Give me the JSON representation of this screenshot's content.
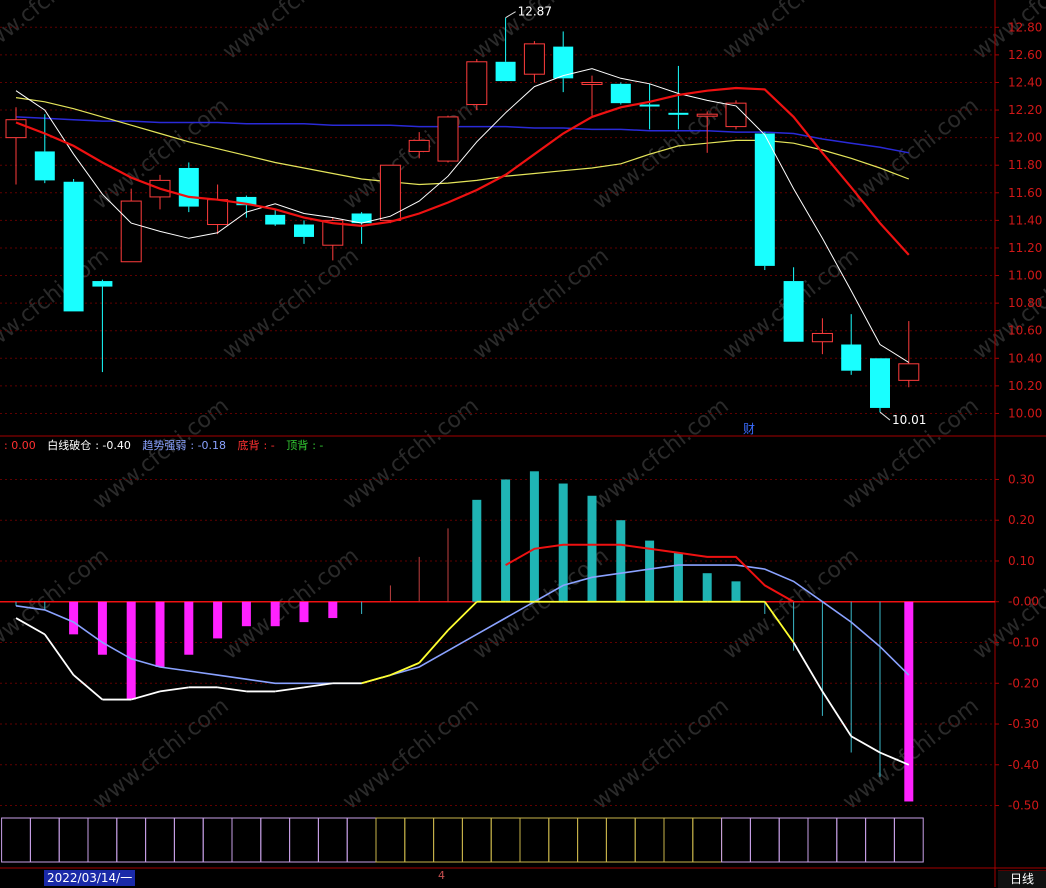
{
  "chart_data": [
    {
      "type": "candlestick",
      "panel": "price",
      "y_ticks": [
        "12.80",
        "12.60",
        "12.40",
        "12.20",
        "12.00",
        "11.80",
        "11.60",
        "11.40",
        "11.20",
        "11.00",
        "10.80",
        "10.60",
        "10.40",
        "10.20",
        "10.00"
      ],
      "ylim": [
        9.88,
        12.94
      ],
      "grid": true,
      "candles": [
        {
          "o": 12.0,
          "c": 12.13,
          "h": 12.22,
          "l": 11.66
        },
        {
          "o": 11.9,
          "c": 11.69,
          "h": 12.17,
          "l": 11.67
        },
        {
          "o": 11.68,
          "c": 10.74,
          "h": 11.7,
          "l": 10.74
        },
        {
          "o": 10.96,
          "c": 10.92,
          "h": 10.97,
          "l": 10.3
        },
        {
          "o": 11.1,
          "c": 11.54,
          "h": 11.63,
          "l": 11.1
        },
        {
          "o": 11.57,
          "c": 11.69,
          "h": 11.73,
          "l": 11.48
        },
        {
          "o": 11.78,
          "c": 11.5,
          "h": 11.82,
          "l": 11.46
        },
        {
          "o": 11.37,
          "c": 11.55,
          "h": 11.66,
          "l": 11.3
        },
        {
          "o": 11.57,
          "c": 11.51,
          "h": 11.58,
          "l": 11.42
        },
        {
          "o": 11.44,
          "c": 11.37,
          "h": 11.48,
          "l": 11.36
        },
        {
          "o": 11.37,
          "c": 11.28,
          "h": 11.4,
          "l": 11.23
        },
        {
          "o": 11.22,
          "c": 11.4,
          "h": 11.42,
          "l": 11.11
        },
        {
          "o": 11.45,
          "c": 11.38,
          "h": 11.46,
          "l": 11.23
        },
        {
          "o": 11.4,
          "c": 11.8,
          "h": 11.8,
          "l": 11.38
        },
        {
          "o": 11.9,
          "c": 11.98,
          "h": 12.04,
          "l": 11.85
        },
        {
          "o": 11.83,
          "c": 12.15,
          "h": 12.16,
          "l": 11.82
        },
        {
          "o": 12.24,
          "c": 12.55,
          "h": 12.57,
          "l": 12.2
        },
        {
          "o": 12.55,
          "c": 12.41,
          "h": 12.87,
          "l": 12.41
        },
        {
          "o": 12.46,
          "c": 12.68,
          "h": 12.7,
          "l": 12.4
        },
        {
          "o": 12.66,
          "c": 12.43,
          "h": 12.77,
          "l": 12.33
        },
        {
          "o": 12.4,
          "c": 12.4,
          "h": 12.45,
          "l": 12.16
        },
        {
          "o": 12.39,
          "c": 12.25,
          "h": 12.4,
          "l": 12.24
        },
        {
          "o": 12.24,
          "c": 12.23,
          "h": 12.39,
          "l": 12.06
        },
        {
          "o": 12.18,
          "c": 12.17,
          "h": 12.52,
          "l": 12.06
        },
        {
          "o": 12.16,
          "c": 12.17,
          "h": 12.19,
          "l": 11.89
        },
        {
          "o": 12.08,
          "c": 12.25,
          "h": 12.27,
          "l": 12.06
        },
        {
          "o": 12.03,
          "c": 11.07,
          "h": 12.04,
          "l": 11.04
        },
        {
          "o": 10.96,
          "c": 10.52,
          "h": 11.06,
          "l": 10.52
        },
        {
          "o": 10.52,
          "c": 10.58,
          "h": 10.69,
          "l": 10.43
        },
        {
          "o": 10.5,
          "c": 10.31,
          "h": 10.72,
          "l": 10.28
        },
        {
          "o": 10.4,
          "c": 10.04,
          "h": 10.4,
          "l": 10.01
        },
        {
          "o": 10.24,
          "c": 10.36,
          "h": 10.67,
          "l": 10.19
        }
      ],
      "ma_white": [
        12.34,
        12.2,
        11.88,
        11.59,
        11.38,
        11.32,
        11.27,
        11.31,
        11.46,
        11.52,
        11.45,
        11.42,
        11.38,
        11.43,
        11.54,
        11.72,
        11.97,
        12.18,
        12.37,
        12.45,
        12.5,
        12.43,
        12.39,
        12.32,
        12.27,
        12.23,
        12.02,
        11.63,
        11.27,
        10.89,
        10.5,
        10.37
      ],
      "ma_yellow": [
        12.29,
        12.26,
        12.21,
        12.15,
        12.09,
        12.03,
        11.97,
        11.92,
        11.87,
        11.82,
        11.78,
        11.74,
        11.7,
        11.68,
        11.66,
        11.67,
        11.69,
        11.72,
        11.74,
        11.76,
        11.78,
        11.81,
        11.88,
        11.94,
        11.96,
        11.98,
        11.98,
        11.96,
        11.91,
        11.85,
        11.78,
        11.7
      ],
      "ma_red": [
        12.11,
        12.03,
        11.94,
        11.82,
        11.71,
        11.63,
        11.57,
        11.55,
        11.52,
        11.48,
        11.42,
        11.38,
        11.36,
        11.39,
        11.45,
        11.53,
        11.62,
        11.73,
        11.88,
        12.03,
        12.15,
        12.22,
        12.26,
        12.31,
        12.34,
        12.36,
        12.35,
        12.15,
        11.89,
        11.64,
        11.38,
        11.15
      ],
      "ma_blue": [
        12.15,
        12.14,
        12.13,
        12.12,
        12.12,
        12.11,
        12.11,
        12.11,
        12.1,
        12.1,
        12.1,
        12.09,
        12.09,
        12.09,
        12.08,
        12.08,
        12.08,
        12.08,
        12.07,
        12.07,
        12.06,
        12.06,
        12.05,
        12.05,
        12.05,
        12.04,
        12.04,
        12.03,
        11.99,
        11.96,
        11.93,
        11.89
      ],
      "annotations": [
        {
          "index": 17,
          "value": 12.87,
          "label": "12.87"
        },
        {
          "index": 30,
          "value": 10.01,
          "label": "10.01"
        }
      ],
      "marker_label": "财"
    },
    {
      "type": "bar",
      "panel": "indicator",
      "y_ticks": [
        "0.30",
        "0.20",
        "0.10",
        "-0.00",
        "-0.10",
        "-0.20",
        "-0.30",
        "-0.40",
        "-0.50"
      ],
      "ylim": [
        -0.56,
        0.36
      ],
      "series": [
        {
          "values": [
            -0.01,
            -0.02,
            -0.08,
            -0.13,
            -0.24,
            -0.16,
            -0.13,
            -0.09,
            -0.06,
            -0.06,
            -0.05,
            -0.04,
            -0.03,
            0.04,
            0.11,
            0.18,
            0.25,
            0.3,
            0.32,
            0.29,
            0.26,
            0.2,
            0.15,
            0.12,
            0.07,
            0.05,
            -0.03,
            -0.12,
            -0.28,
            -0.37,
            -0.43,
            -0.49
          ]
        },
        {
          "values": [
            -0.04,
            -0.08,
            -0.18,
            -0.24,
            -0.24,
            -0.22,
            -0.21,
            -0.21,
            -0.22,
            -0.22,
            -0.21,
            -0.2,
            -0.2,
            -0.18,
            -0.15,
            -0.07,
            0.0,
            0.0,
            0.0,
            0.0,
            0.0,
            0.0,
            0.0,
            0.0,
            0.0,
            0.0,
            0.0,
            -0.1,
            -0.22,
            -0.33,
            -0.37,
            -0.4
          ]
        },
        {
          "values": [
            -0.01,
            -0.02,
            -0.05,
            -0.1,
            -0.14,
            -0.16,
            -0.17,
            -0.18,
            -0.19,
            -0.2,
            -0.2,
            -0.2,
            -0.2,
            -0.18,
            -0.16,
            -0.12,
            -0.08,
            -0.04,
            0.0,
            0.04,
            0.06,
            0.07,
            0.08,
            0.09,
            0.09,
            0.09,
            0.08,
            0.05,
            0.0,
            -0.05,
            -0.11,
            -0.18
          ]
        },
        {
          "values": [
            null,
            null,
            null,
            null,
            null,
            null,
            null,
            null,
            null,
            null,
            null,
            null,
            null,
            null,
            null,
            null,
            null,
            0.09,
            0.13,
            0.14,
            0.14,
            0.14,
            0.13,
            0.12,
            0.11,
            0.11,
            0.04,
            0.0,
            null,
            null,
            null,
            null
          ]
        }
      ]
    }
  ],
  "legend": {
    "item0": {
      "label": "",
      "value": ": 0.00",
      "color": "#ff3030"
    },
    "item1": {
      "label": "白线破仓",
      "value": ": -0.40",
      "color": "#ffffff"
    },
    "item2": {
      "label": "趋势强弱",
      "value": ": -0.18",
      "color": "#8aa2ff"
    },
    "item3": {
      "label": "底背",
      "value": ": -",
      "color": "#ff3030"
    },
    "item4": {
      "label": "顶背",
      "value": ": -",
      "color": "#33cc33"
    }
  },
  "footer": {
    "date": "2022/03/14/一",
    "tab_marker": "4",
    "period": "日线"
  },
  "watermark": "www.cfchi.com",
  "colors": {
    "up": "#ff3c3c",
    "down": "#19ffff",
    "axis": "#a50000",
    "grid": "#600000",
    "ma_white": "#ffffff",
    "ma_yellow": "#e4e45a",
    "ma_red": "#ee1111",
    "ma_blue": "#2a2ad8",
    "macd_pos_bar": "#1fb4b4",
    "macd_neg_bar": "#ff22ff",
    "macd_line_blue": "#8aa2ff",
    "macd_line_yellow": "#ffff30"
  }
}
